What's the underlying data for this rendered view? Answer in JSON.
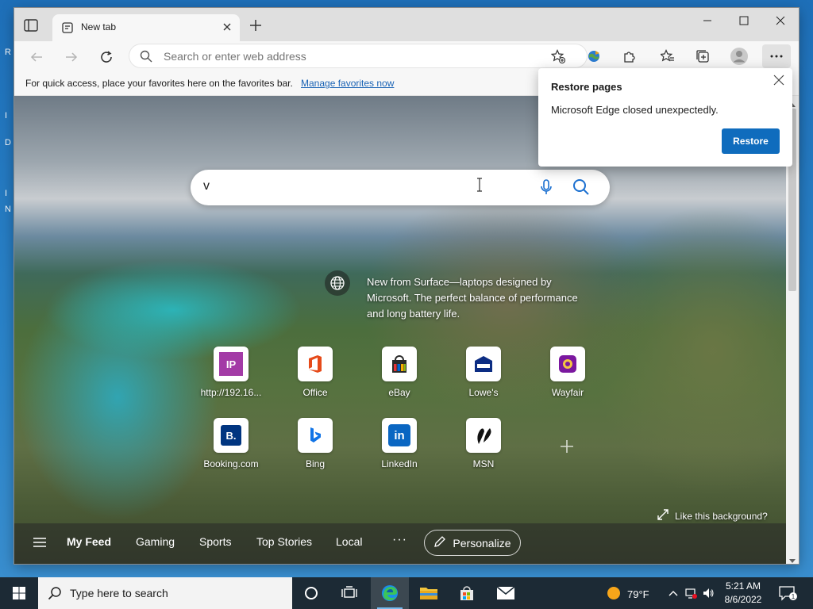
{
  "desktop": {
    "edge_glyphs": [
      "R",
      "I",
      "D",
      "I",
      "N"
    ]
  },
  "browser": {
    "tab": {
      "title": "New tab"
    },
    "address": {
      "placeholder": "Search or enter web address",
      "value": ""
    },
    "favorites_bar": {
      "message": "For quick access, place your favorites here on the favorites bar.",
      "link": "Manage favorites now"
    }
  },
  "newtab": {
    "search": {
      "value": "v"
    },
    "promo": {
      "text": "New from Surface—laptops designed by Microsoft. The perfect balance of performance and long battery life."
    },
    "tiles": [
      {
        "label": "http://192.16...",
        "icon": "ip-icon",
        "glyph": "IP",
        "color": "#a33ba6"
      },
      {
        "label": "Office",
        "icon": "office-icon",
        "glyph": "O",
        "color": "#e64a19"
      },
      {
        "label": "eBay",
        "icon": "ebay-icon",
        "glyph": "bag",
        "color": "#2a2a2a"
      },
      {
        "label": "Lowe's",
        "icon": "lowes-icon",
        "glyph": "L",
        "color": "#0c2d83"
      },
      {
        "label": "Wayfair",
        "icon": "wayfair-icon",
        "glyph": "W",
        "color": "#7b189f"
      },
      {
        "label": "Booking.com",
        "icon": "booking-icon",
        "glyph": "B.",
        "color": "#003580"
      },
      {
        "label": "Bing",
        "icon": "bing-icon",
        "glyph": "b",
        "color": "#1174e6"
      },
      {
        "label": "LinkedIn",
        "icon": "linkedin-icon",
        "glyph": "in",
        "color": "#0a66c2"
      },
      {
        "label": "MSN",
        "icon": "msn-icon",
        "glyph": "msn",
        "color": "#111111"
      }
    ],
    "background_link": "Like this background?",
    "feed": {
      "items": [
        "My Feed",
        "Gaming",
        "Sports",
        "Top Stories",
        "Local"
      ],
      "active": "My Feed",
      "more": "···",
      "personalize": "Personalize"
    }
  },
  "popup": {
    "title": "Restore pages",
    "message": "Microsoft Edge closed unexpectedly.",
    "button": "Restore"
  },
  "taskbar": {
    "search_placeholder": "Type here to search",
    "weather": "79°F",
    "time": "5:21 AM",
    "date": "8/6/2022",
    "notification_count": "1"
  }
}
